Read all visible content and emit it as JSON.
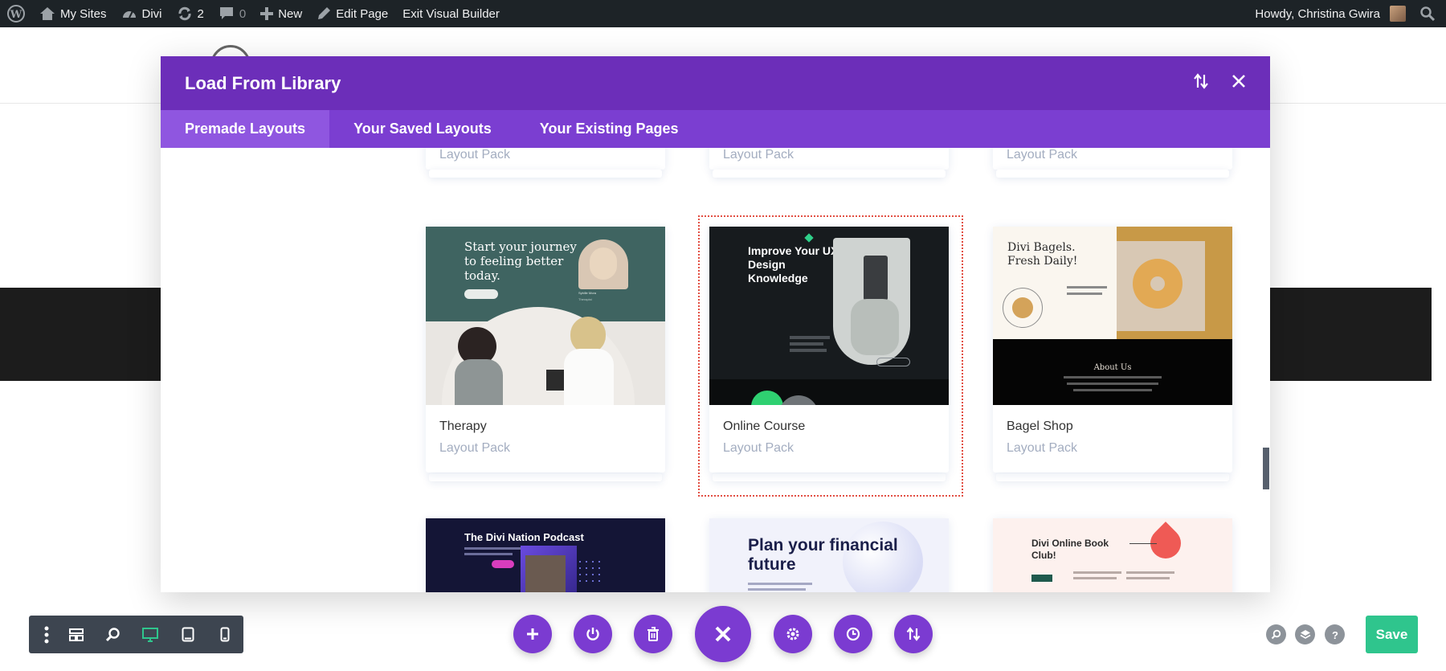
{
  "admin_bar": {
    "my_sites": "My Sites",
    "divi": "Divi",
    "updates_count": "2",
    "comments_count": "0",
    "new": "New",
    "edit_page": "Edit Page",
    "exit_builder": "Exit Visual Builder",
    "howdy": "Howdy, Christina Gwira"
  },
  "modal": {
    "title": "Load From Library",
    "tabs": [
      {
        "label": "Premade Layouts",
        "active": true
      },
      {
        "label": "Your Saved Layouts",
        "active": false
      },
      {
        "label": "Your Existing Pages",
        "active": false
      }
    ],
    "top_row_types": [
      "Layout Pack",
      "Layout Pack",
      "Layout Pack"
    ],
    "cards": [
      {
        "name": "Therapy",
        "type": "Layout Pack",
        "selected": false,
        "thumb": {
          "headline": "Start your journey to feeling better today.",
          "person": "Sybille Mora",
          "role": "Therapist"
        }
      },
      {
        "name": "Online Course",
        "type": "Layout Pack",
        "selected": true,
        "thumb": {
          "headline": "Improve Your UX Design Knowledge"
        }
      },
      {
        "name": "Bagel Shop",
        "type": "Layout Pack",
        "selected": false,
        "thumb": {
          "headline": "Divi Bagels. Fresh Daily!",
          "section": "About Us"
        }
      }
    ],
    "bottom_row": [
      {
        "headline": "The Divi Nation Podcast"
      },
      {
        "headline": "Plan your financial future"
      },
      {
        "headline": "Divi Online Book Club!"
      }
    ]
  },
  "builder": {
    "save_label": "Save"
  },
  "colors": {
    "accent_purple": "#6c2eb9",
    "tab_purple": "#7b3ed1",
    "save_green": "#2fc58d",
    "selection_red": "#e24f43"
  }
}
